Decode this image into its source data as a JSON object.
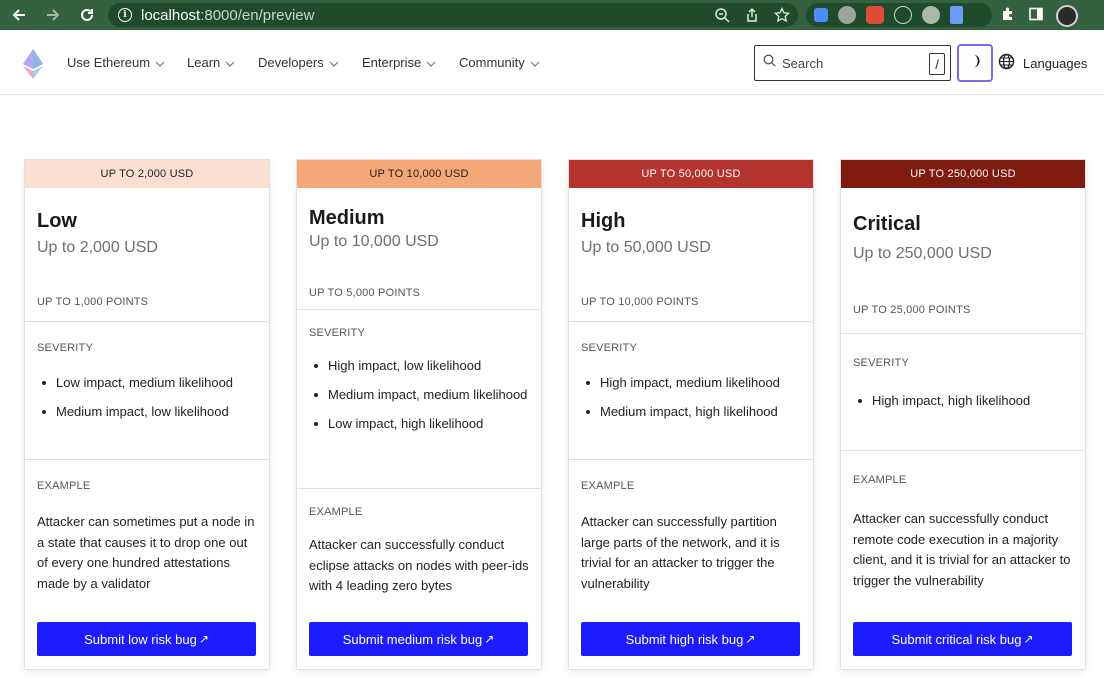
{
  "browser": {
    "url_host": "localhost",
    "url_rest": ":8000/en/preview"
  },
  "header": {
    "menu": [
      "Use Ethereum",
      "Learn",
      "Developers",
      "Enterprise",
      "Community"
    ],
    "search_placeholder": "Search",
    "search_shortcut": "/",
    "languages_label": "Languages"
  },
  "colors": {
    "accent": "#1c1cff",
    "low": "#fbe0d2",
    "medium": "#f5a877",
    "high": "#b5332f",
    "critical": "#7f1a0e"
  },
  "cards": [
    {
      "banner": "UP TO 2,000 USD",
      "title": "Low",
      "subtitle": "Up to 2,000 USD",
      "points": "UP TO 1,000 POINTS",
      "severity_label": "SEVERITY",
      "severity": [
        "Low impact, medium likelihood",
        "Medium impact, low likelihood"
      ],
      "example_label": "EXAMPLE",
      "example": "Attacker can sometimes put a node in a state that causes it to drop one out of every one hundred attestations made by a validator",
      "button": "Submit low risk bug"
    },
    {
      "banner": "UP TO 10,000 USD",
      "title": "Medium",
      "subtitle": "Up to 10,000 USD",
      "points": "UP TO 5,000 POINTS",
      "severity_label": "SEVERITY",
      "severity": [
        "High impact, low likelihood",
        "Medium impact, medium likelihood",
        "Low impact, high likelihood"
      ],
      "example_label": "EXAMPLE",
      "example": "Attacker can successfully conduct eclipse attacks on nodes with peer-ids with 4 leading zero bytes",
      "button": "Submit medium risk bug"
    },
    {
      "banner": "UP TO 50,000 USD",
      "title": "High",
      "subtitle": "Up to 50,000 USD",
      "points": "UP TO 10,000 POINTS",
      "severity_label": "SEVERITY",
      "severity": [
        "High impact, medium likelihood",
        "Medium impact, high likelihood"
      ],
      "example_label": "EXAMPLE",
      "example": "Attacker can successfully partition large parts of the network, and it is trivial for an attacker to trigger the vulnerability",
      "button": "Submit high risk bug"
    },
    {
      "banner": "UP TO 250,000 USD",
      "title": "Critical",
      "subtitle": "Up to 250,000 USD",
      "points": "UP TO 25,000 POINTS",
      "severity_label": "SEVERITY",
      "severity": [
        "High impact, high likelihood"
      ],
      "example_label": "EXAMPLE",
      "example": "Attacker can successfully conduct remote code execution in a majority client, and it is trivial for an attacker to trigger the vulnerability",
      "button": "Submit critical risk bug"
    }
  ]
}
